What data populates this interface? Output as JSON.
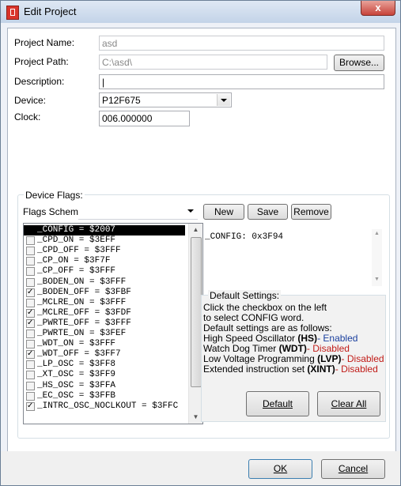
{
  "window": {
    "title": "Edit Project",
    "close_glyph": "x"
  },
  "project": {
    "name_label": "Project Name:",
    "name_value": "asd",
    "path_label": "Project Path:",
    "path_value": "C:\\asd\\",
    "browse_label": "Browse...",
    "description_label": "Description:",
    "description_value": "|",
    "device_label": "Device:",
    "device_value": "P12F675",
    "clock_label": "Clock:",
    "clock_value": "006.000000"
  },
  "flags": {
    "group_title": "Device Flags:",
    "scheme_label": "Flags Scheme:",
    "scheme_value": "",
    "new_label": "New",
    "save_label": "Save",
    "remove_label": "Remove",
    "items": [
      {
        "text": "_CONFIG = $2007",
        "checked": false,
        "selected": true,
        "header": true
      },
      {
        "text": "_CPD_ON = $3EFF",
        "checked": false
      },
      {
        "text": "_CPD_OFF = $3FFF",
        "checked": false
      },
      {
        "text": "_CP_ON = $3F7F",
        "checked": false
      },
      {
        "text": "_CP_OFF = $3FFF",
        "checked": false
      },
      {
        "text": "_BODEN_ON = $3FFF",
        "checked": false
      },
      {
        "text": "_BODEN_OFF = $3FBF",
        "checked": true
      },
      {
        "text": "_MCLRE_ON = $3FFF",
        "checked": false
      },
      {
        "text": "_MCLRE_OFF = $3FDF",
        "checked": true
      },
      {
        "text": "_PWRTE_OFF = $3FFF",
        "checked": true
      },
      {
        "text": "_PWRTE_ON = $3FEF",
        "checked": false
      },
      {
        "text": "_WDT_ON = $3FFF",
        "checked": false
      },
      {
        "text": "_WDT_OFF = $3FF7",
        "checked": true
      },
      {
        "text": "_LP_OSC = $3FF8",
        "checked": false
      },
      {
        "text": "_XT_OSC = $3FF9",
        "checked": false
      },
      {
        "text": "_HS_OSC = $3FFA",
        "checked": false
      },
      {
        "text": "_EC_OSC = $3FFB",
        "checked": false
      },
      {
        "text": "_INTRC_OSC_NOCLKOUT = $3FFC",
        "checked": true
      }
    ],
    "config_text": "_CONFIG: 0x3F94"
  },
  "defaults": {
    "title": "Default Settings:",
    "line1": "Click the checkbox on the left",
    "line2": "to select CONFIG word.",
    "line3": "Default settings are as follows:",
    "hs_prefix": "High Speed Oscillator ",
    "hs_abbr": "(HS)",
    "hs_state": "- Enabled",
    "wdt_prefix": "Watch Dog Timer ",
    "wdt_abbr": "(WDT)",
    "wdt_state": "- Disabled",
    "lvp_prefix": "Low Voltage Programming ",
    "lvp_abbr": "(LVP)",
    "lvp_state": "- Disabled",
    "xint_prefix": "Extended instruction set ",
    "xint_abbr": "(XINT)",
    "xint_state": "- Disabled",
    "default_button": "Default",
    "clear_button": "Clear All"
  },
  "footer": {
    "ok_label": "OK",
    "cancel_label": "Cancel"
  },
  "colors": {
    "enabled": "#1a3f9e",
    "disabled": "#c11b17",
    "selection": "#000000"
  }
}
